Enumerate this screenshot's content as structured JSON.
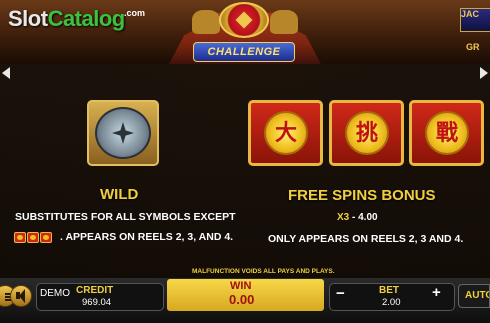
{
  "header": {
    "logo_main": "Slot",
    "logo_accent": "Catalog",
    "logo_suffix": ".com",
    "game_banner": "CHALLENGE",
    "jackpot_label": "JAC",
    "grand_label": "GR"
  },
  "paytable": {
    "wild": {
      "title": "WILD",
      "line1": "SUBSTITUTES FOR ALL SYMBOLS EXCEPT",
      "line2": ". APPEARS ON REELS  2, 3, AND 4."
    },
    "free_spins": {
      "title": "FREE SPINS BONUS",
      "multiplier_label": "X3",
      "multiplier_value": " - 4.00",
      "note": "ONLY APPEARS ON REELS 2, 3 AND 4.",
      "symbols": [
        "大",
        "挑",
        "戰"
      ]
    },
    "malfunction_notice": "MALFUNCTION VOIDS ALL PAYS AND PLAYS."
  },
  "bottom_bar": {
    "mode": "DEMO",
    "credit_label": "CREDIT",
    "credit_value": "969.04",
    "win_label": "WIN",
    "win_value": "0.00",
    "bet_label": "BET",
    "bet_value": "2.00",
    "minus": "−",
    "plus": "+",
    "auto_label": "AUTO"
  },
  "colors": {
    "gold": "#f0d040",
    "red_tile": "#d02818",
    "win_text": "#a01010"
  }
}
